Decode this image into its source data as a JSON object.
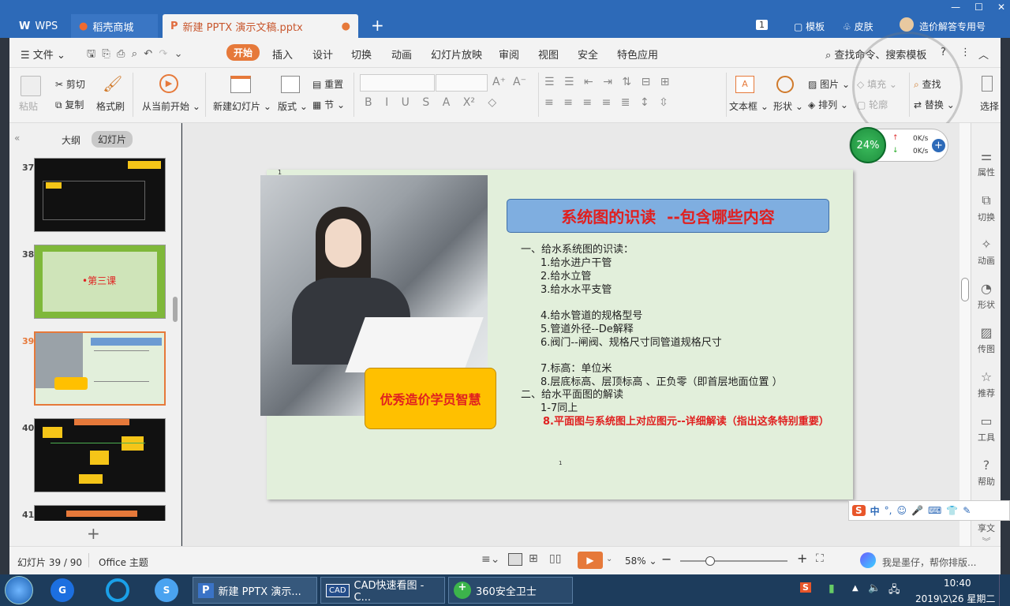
{
  "tabs": [
    {
      "label": "WPS"
    },
    {
      "label": "稻壳商城"
    },
    {
      "label": "新建 PPTX 演示文稿.pptx"
    }
  ],
  "titlebar": {
    "badge": "1",
    "template": "模板",
    "skin": "皮肤",
    "user": "造价解答专用号"
  },
  "menu": {
    "file": "文件",
    "items": [
      "开始",
      "插入",
      "设计",
      "切换",
      "动画",
      "幻灯片放映",
      "审阅",
      "视图",
      "安全",
      "特色应用"
    ],
    "search": "查找命令、搜索模板",
    "help": "?"
  },
  "ribbon": {
    "paste": "粘贴",
    "cut": "剪切",
    "copy": "复制",
    "format_painter": "格式刷",
    "from_start": "从当前开始",
    "new_slide": "新建幻灯片",
    "layout": "版式",
    "reset": "重置",
    "section": "节",
    "textbox": "文本框",
    "shape": "形状",
    "picture": "图片",
    "arrange": "排列",
    "fill": "填充",
    "find": "查找",
    "replace": "替换",
    "select": "选择",
    "outline_shape": "轮廓"
  },
  "net": {
    "percent": "24%",
    "up": "0K/s",
    "down": "0K/s"
  },
  "panel": {
    "tab_outline": "大纲",
    "tab_slides": "幻灯片"
  },
  "thumbs": [
    {
      "num": "37"
    },
    {
      "num": "38",
      "text": "•第三课"
    },
    {
      "num": "39"
    },
    {
      "num": "40"
    },
    {
      "num": "41"
    }
  ],
  "slide": {
    "title": "系统图的识读  --包含哪些内容",
    "badge": "优秀造价学员智慧",
    "lines": [
      "一、给水系统图的识读：",
      "1.给水进户干管",
      "2.给水立管",
      "3.给水水平支管",
      "4.给水管道的规格型号",
      "5.管道外径--De解释",
      "6.阀门--闸阀、规格尺寸同管道规格尺寸",
      "7.标高：单位米",
      "8.层底标高、层顶标高 、正负零（即首层地面位置 ）",
      "二、给水平面图的解读",
      "1-7同上",
      "8.平面图与系统图上对应图元--详细解读（指出这条特别重要）"
    ],
    "slide_no": "1"
  },
  "rightbar": [
    "属性",
    "切换",
    "动画",
    "形状",
    "传图",
    "推荐",
    "工具",
    "帮助"
  ],
  "ime": {
    "label": "中",
    "share": "享文"
  },
  "status": {
    "slide": "幻灯片 39 / 90",
    "theme": "Office 主题",
    "zoom": "58%",
    "ai": "我是墨仔，帮你排版..."
  },
  "taskbar": {
    "items": [
      "新建 PPTX 演示...",
      "CAD快速看图 - C...",
      "360安全卫士"
    ],
    "time": "10:40",
    "date": "2019\\2\\26 星期二"
  },
  "colors": {
    "brand": "#2d6ab8",
    "accent": "#e6793a",
    "title_red": "#e02020"
  }
}
